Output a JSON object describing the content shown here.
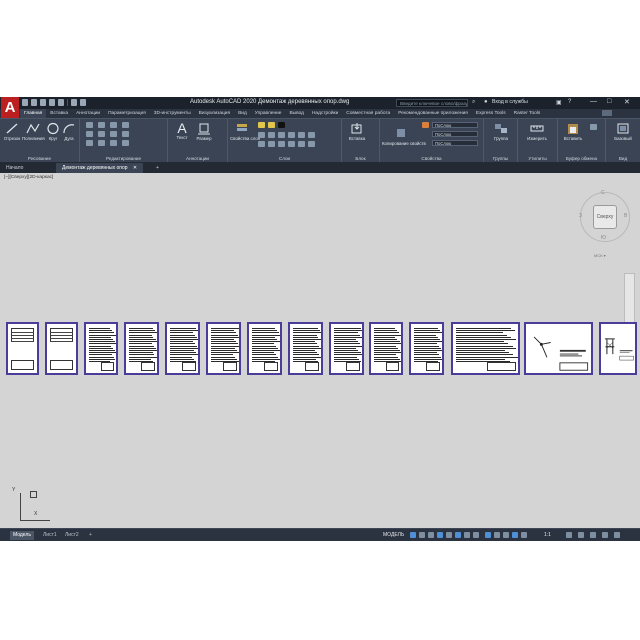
{
  "app": {
    "title": "Autodesk AutoCAD 2020   Демонтаж деревянных опор.dwg",
    "logo_letter": "A",
    "search_placeholder": "Введите ключевое слово/фразу",
    "login": "Вход в службы",
    "window_controls": [
      "—",
      "□",
      "✕"
    ]
  },
  "ribbon_tabs": [
    "Главная",
    "Вставка",
    "Аннотации",
    "Параметризация",
    "3D-инструменты",
    "Визуализация",
    "Вид",
    "Управление",
    "Вывод",
    "Надстройки",
    "Совместная работа",
    "Рекомендованные приложения",
    "Express Tools",
    "Raster Tools"
  ],
  "ribbon": {
    "draw": {
      "tools": [
        "Отрезок",
        "Полилиния",
        "Круг",
        "Дуга"
      ],
      "title": "Рисование"
    },
    "modify": {
      "title": "Редактирование"
    },
    "annotation": {
      "tools": [
        "Текст",
        "Размер"
      ],
      "title": "Аннотации"
    },
    "layers": {
      "tool": "Свойства слоя",
      "title": "Слои"
    },
    "block": {
      "tool": "Вставка",
      "title": "Блок"
    },
    "properties": {
      "tool": "Копирование свойств",
      "title": "Свойства",
      "values": [
        "ПоСлою",
        "ПоСлою",
        "ПоСлою"
      ]
    },
    "groups": {
      "tool": "Группа",
      "title": "Группы"
    },
    "utilities": {
      "tool": "Измерить",
      "title": "Утилиты"
    },
    "clipboard": {
      "tool": "Вставить",
      "title": "Буфер обмена"
    },
    "view": {
      "tool": "Базовый",
      "title": "Вид"
    }
  },
  "file_tabs": [
    "Начало",
    "Демонтаж деревянных опор"
  ],
  "viewport": {
    "label": "[−][Сверху][2D-каркас]",
    "viewcube_face": "Сверху",
    "cardinals": [
      "С",
      "В",
      "Ю",
      "З"
    ],
    "wcs": "МСК ▾",
    "ucs_x": "X",
    "ucs_y": "Y"
  },
  "sheets": [
    {
      "kind": "form"
    },
    {
      "kind": "form"
    },
    {
      "kind": "text"
    },
    {
      "kind": "text"
    },
    {
      "kind": "text"
    },
    {
      "kind": "text"
    },
    {
      "kind": "text"
    },
    {
      "kind": "text"
    },
    {
      "kind": "text"
    },
    {
      "kind": "text"
    },
    {
      "kind": "text"
    },
    {
      "kind": "text"
    },
    {
      "kind": "drawing"
    },
    {
      "kind": "drawing-support"
    },
    {
      "kind": "text"
    }
  ],
  "layout_tabs": [
    "Модель",
    "Лист1",
    "Лист2",
    "+"
  ],
  "status": {
    "model": "МОДЕЛЬ",
    "scale": "1:1"
  },
  "colors": {
    "accent": "#4a3d9a",
    "canvas": "#d4d4d4",
    "chrome": "#2b3340",
    "logo": "#bb1f1f"
  }
}
